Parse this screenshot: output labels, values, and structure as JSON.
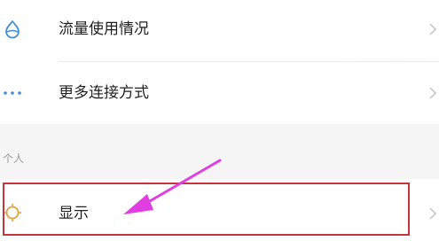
{
  "settings": {
    "items": [
      {
        "label": "流量使用情况",
        "icon": "data-usage-drop-icon"
      },
      {
        "label": "更多连接方式",
        "icon": "more-dots-icon"
      }
    ],
    "section_personal": {
      "header": "个人",
      "items": [
        {
          "label": "显示",
          "icon": "display-sun-icon"
        }
      ]
    }
  },
  "annotation": {
    "arrow_color": "#e03ee0",
    "box_color": "#c4343a"
  }
}
